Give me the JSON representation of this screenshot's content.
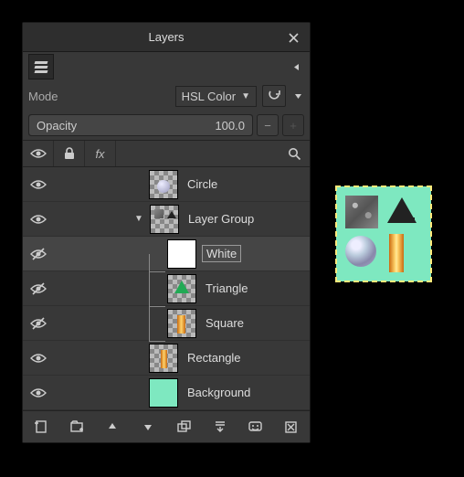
{
  "panel": {
    "title": "Layers",
    "mode_label": "Mode",
    "mode_value": "HSL Color",
    "opacity_label": "Opacity",
    "opacity_value": "100.0"
  },
  "layers": [
    {
      "name": "Circle",
      "visible": true,
      "indent": 0,
      "thumb": "circle",
      "selected": false,
      "expandable": false
    },
    {
      "name": "Layer Group",
      "visible": true,
      "indent": 0,
      "thumb": "group",
      "selected": false,
      "expandable": true
    },
    {
      "name": "White",
      "visible": false,
      "indent": 1,
      "thumb": "white",
      "selected": true,
      "expandable": false
    },
    {
      "name": "Triangle",
      "visible": false,
      "indent": 1,
      "thumb": "triangle",
      "selected": false,
      "expandable": false
    },
    {
      "name": "Square",
      "visible": false,
      "indent": 1,
      "thumb": "square",
      "selected": false,
      "expandable": false
    },
    {
      "name": "Rectangle",
      "visible": true,
      "indent": 0,
      "thumb": "rectangle",
      "selected": false,
      "expandable": false
    },
    {
      "name": "Background",
      "visible": true,
      "indent": 0,
      "thumb": "mint",
      "selected": false,
      "expandable": false
    }
  ],
  "icons": {
    "close": "✕",
    "search": "⌕",
    "eye": "👁",
    "lock": "🔒",
    "fx": "fx"
  }
}
